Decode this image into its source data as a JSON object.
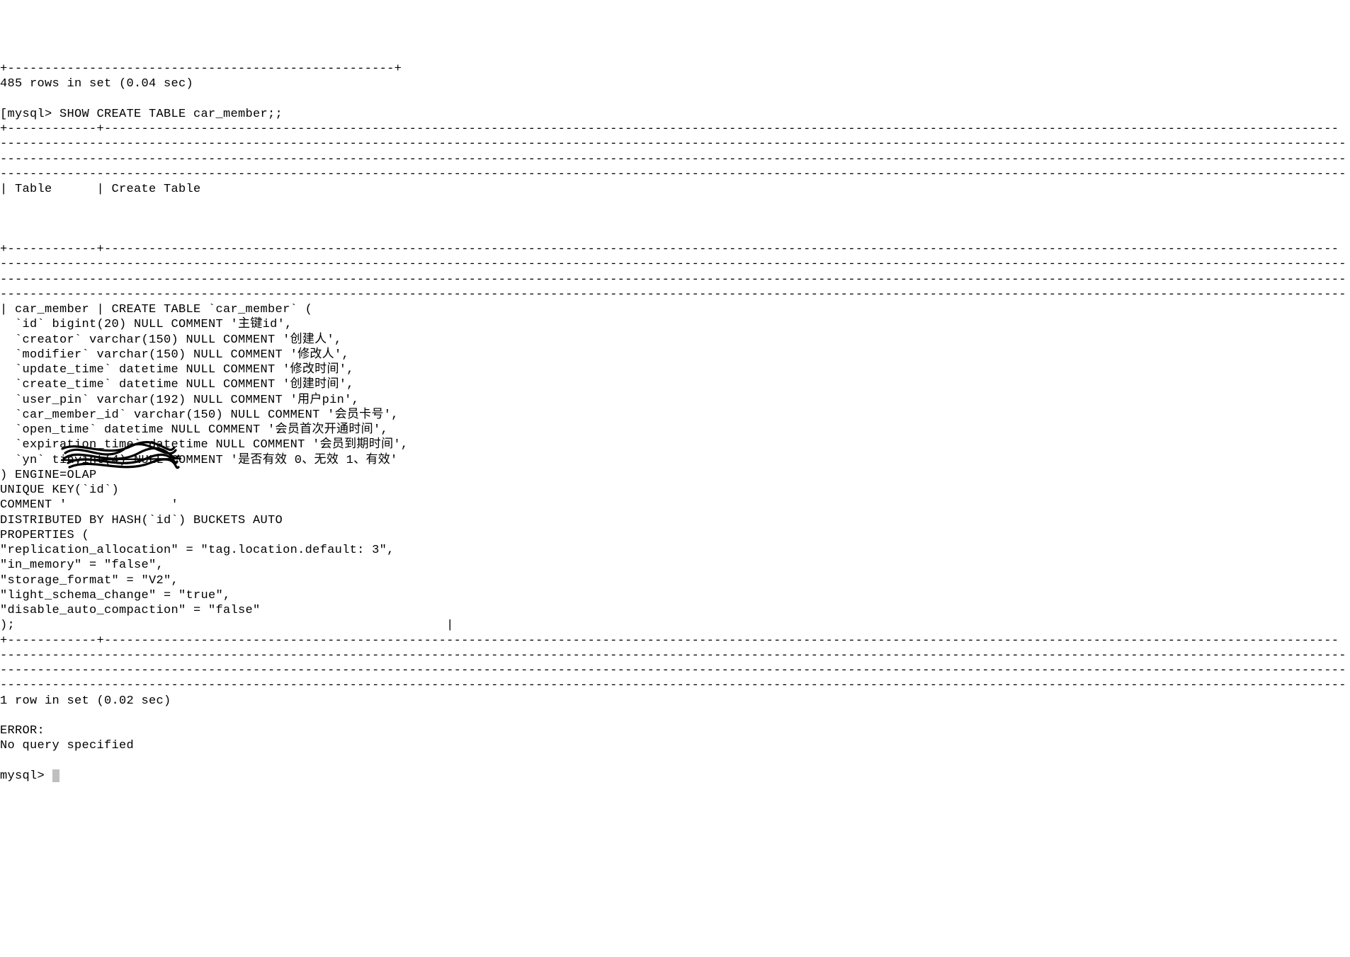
{
  "header_rule": "+----------------------------------------------------+",
  "rows_in_set": "485 rows in set (0.04 sec)",
  "blank": "",
  "prompt_line": "[mysql> SHOW CREATE TABLE car_member;;",
  "long_rule_top": "+------------+----------------------------------------------------------------------------------------------------------------------------------------------------------------------",
  "long_dash": "-------------------------------------------------------------------------------------------------------------------------------------------------------------------------------------",
  "header_row": "| Table      | Create Table",
  "table_name": "| car_member | CREATE TABLE `car_member` (",
  "col_id": "  `id` bigint(20) NULL COMMENT '主键id',",
  "col_creator": "  `creator` varchar(150) NULL COMMENT '创建人',",
  "col_modifier": "  `modifier` varchar(150) NULL COMMENT '修改人',",
  "col_update": "  `update_time` datetime NULL COMMENT '修改时间',",
  "col_create": "  `create_time` datetime NULL COMMENT '创建时间',",
  "col_userpin": "  `user_pin` varchar(192) NULL COMMENT '用户pin',",
  "col_memberid": "  `car_member_id` varchar(150) NULL COMMENT '会员卡号',",
  "col_opentime": "  `open_time` datetime NULL COMMENT '会员首次开通时间',",
  "col_exptime": "  `expiration_time` datetime NULL COMMENT '会员到期时间',",
  "col_yn": "  `yn` tinyint(4) NULL COMMENT '是否有效 0、无效 1、有效'",
  "engine": ") ENGINE=OLAP",
  "unique_key": "UNIQUE KEY(`id`)",
  "comment_line": "COMMENT '              '",
  "distributed": "DISTRIBUTED BY HASH(`id`) BUCKETS AUTO",
  "properties": "PROPERTIES (",
  "prop_repl": "\"replication_allocation\" = \"tag.location.default: 3\",",
  "prop_inmem": "\"in_memory\" = \"false\",",
  "prop_storage": "\"storage_format\" = \"V2\",",
  "prop_lsc": "\"light_schema_change\" = \"true\",",
  "prop_dac": "\"disable_auto_compaction\" = \"false\"",
  "close_paren": ");                                                          |",
  "one_row": "1 row in set (0.02 sec)",
  "error_label": "ERROR:",
  "error_msg": "No query specified",
  "final_prompt": "mysql> "
}
